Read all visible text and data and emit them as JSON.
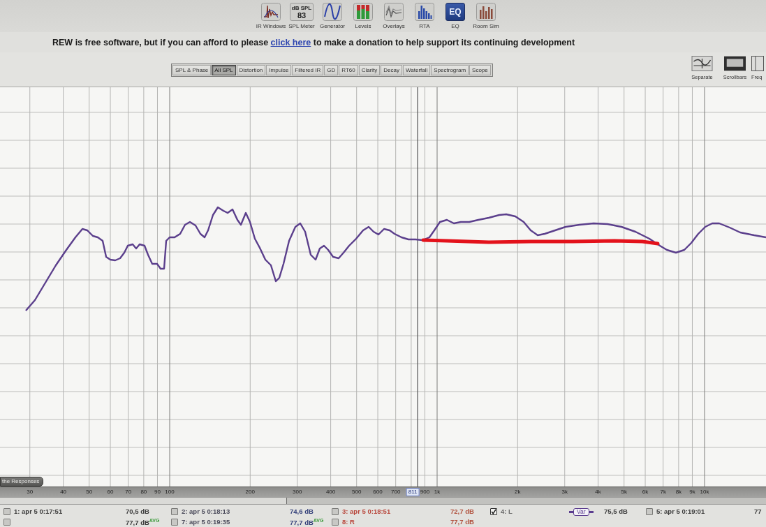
{
  "toolbar": [
    {
      "kind": "ir_windows",
      "label": "IR Windows"
    },
    {
      "kind": "spl_meter",
      "label": "SPL Meter",
      "caption": "dB SPL",
      "reading": "83"
    },
    {
      "kind": "generator",
      "label": "Generator"
    },
    {
      "kind": "levels",
      "label": "Levels"
    },
    {
      "kind": "overlays",
      "label": "Overlays"
    },
    {
      "kind": "rta",
      "label": "RTA"
    },
    {
      "kind": "eq",
      "label": "EQ",
      "tile_text": "EQ"
    },
    {
      "kind": "room_sim",
      "label": "Room Sim"
    }
  ],
  "donation_notice": {
    "text_before": "REW is free software, but if you can afford to please",
    "link": "click here",
    "text_after": "to make a donation to help support its continuing development"
  },
  "tabs": [
    {
      "label": "SPL & Phase",
      "selected": false
    },
    {
      "label": "All SPL",
      "selected": true
    },
    {
      "label": "Distortion",
      "selected": false
    },
    {
      "label": "Impulse",
      "selected": false
    },
    {
      "label": "Filtered IR",
      "selected": false
    },
    {
      "label": "GD",
      "selected": false
    },
    {
      "label": "RT60",
      "selected": false
    },
    {
      "label": "Clarity",
      "selected": false
    },
    {
      "label": "Decay",
      "selected": false
    },
    {
      "label": "Waterfall",
      "selected": false
    },
    {
      "label": "Spectrogram",
      "selected": false
    },
    {
      "label": "Scope",
      "selected": false
    }
  ],
  "view_buttons": [
    {
      "kind": "separate",
      "label": "Separate"
    },
    {
      "kind": "scrollbars",
      "label": "Scrollbars"
    },
    {
      "kind": "freq",
      "label": "Freq"
    }
  ],
  "graph": {
    "limit_button": "the Responses",
    "frequency_axis": [
      {
        "label": "30",
        "selected": false
      },
      {
        "label": "40",
        "selected": false
      },
      {
        "label": "50",
        "selected": false
      },
      {
        "label": "60",
        "selected": false
      },
      {
        "label": "70",
        "selected": false
      },
      {
        "label": "80",
        "selected": false
      },
      {
        "label": "90",
        "selected": false
      },
      {
        "label": "100",
        "selected": false
      },
      {
        "label": "200",
        "selected": false
      },
      {
        "label": "300",
        "selected": false
      },
      {
        "label": "400",
        "selected": false
      },
      {
        "label": "500",
        "selected": false
      },
      {
        "label": "600",
        "selected": false
      },
      {
        "label": "700",
        "selected": false
      },
      {
        "label": "811",
        "selected": true
      },
      {
        "label": "900",
        "selected": false
      },
      {
        "label": "1k",
        "selected": false
      },
      {
        "label": "2k",
        "selected": false
      },
      {
        "label": "3k",
        "selected": false
      },
      {
        "label": "4k",
        "selected": false
      },
      {
        "label": "5k",
        "selected": false
      },
      {
        "label": "6k",
        "selected": false
      },
      {
        "label": "7k",
        "selected": false
      },
      {
        "label": "8k",
        "selected": false
      },
      {
        "label": "9k",
        "selected": false
      },
      {
        "label": "10k",
        "selected": false
      }
    ]
  },
  "legend": {
    "rows": [
      [
        {
          "kind": "measurement",
          "checked": false,
          "label": "1: apr 5 0:17:51",
          "color": "#3a3a3a"
        },
        {
          "kind": "reading",
          "text": "70,5 dB",
          "color": "#3a3a3a"
        },
        {
          "kind": "measurement",
          "checked": false,
          "label": "2: apr 5 0:18:13",
          "color": "#4a4a5a"
        },
        {
          "kind": "reading",
          "text": "74,6 dB",
          "color": "#34407a"
        },
        {
          "kind": "measurement",
          "checked": false,
          "label": "3: apr 5 0:18:51",
          "color": "#b8453a"
        },
        {
          "kind": "reading",
          "text": "72,7 dB",
          "color": "#b0503c"
        },
        {
          "kind": "measurement",
          "checked": true,
          "label": "4: L",
          "color": "#6a6a6a"
        },
        {
          "kind": "trace_style",
          "label": "Var",
          "color": "#5b3d8f"
        },
        {
          "kind": "reading",
          "text": "75,5 dB",
          "color": "#3a3a3a"
        },
        {
          "kind": "measurement",
          "checked": false,
          "label": "5: apr 5 0:19:01",
          "color": "#3a3a3a"
        },
        {
          "kind": "reading",
          "text": "77",
          "color": "#3a3a3a"
        }
      ],
      [
        {
          "kind": "measurement",
          "checked": false
        },
        {
          "kind": "reading",
          "text": "77,7 dB$^{AVG}$",
          "color": "#3a3a3a"
        },
        {
          "kind": "measurement",
          "checked": false,
          "label": "7: apr 5 0:19:35",
          "color": "#4a4a5a"
        },
        {
          "kind": "reading",
          "text": "77,7 dB$^{AVG}$",
          "color": "#34407a"
        },
        {
          "kind": "measurement",
          "checked": false,
          "label": "8: R",
          "color": "#b8453a"
        },
        {
          "kind": "reading",
          "text": "77,7 dB",
          "color": "#b0503c"
        }
      ]
    ]
  }
}
